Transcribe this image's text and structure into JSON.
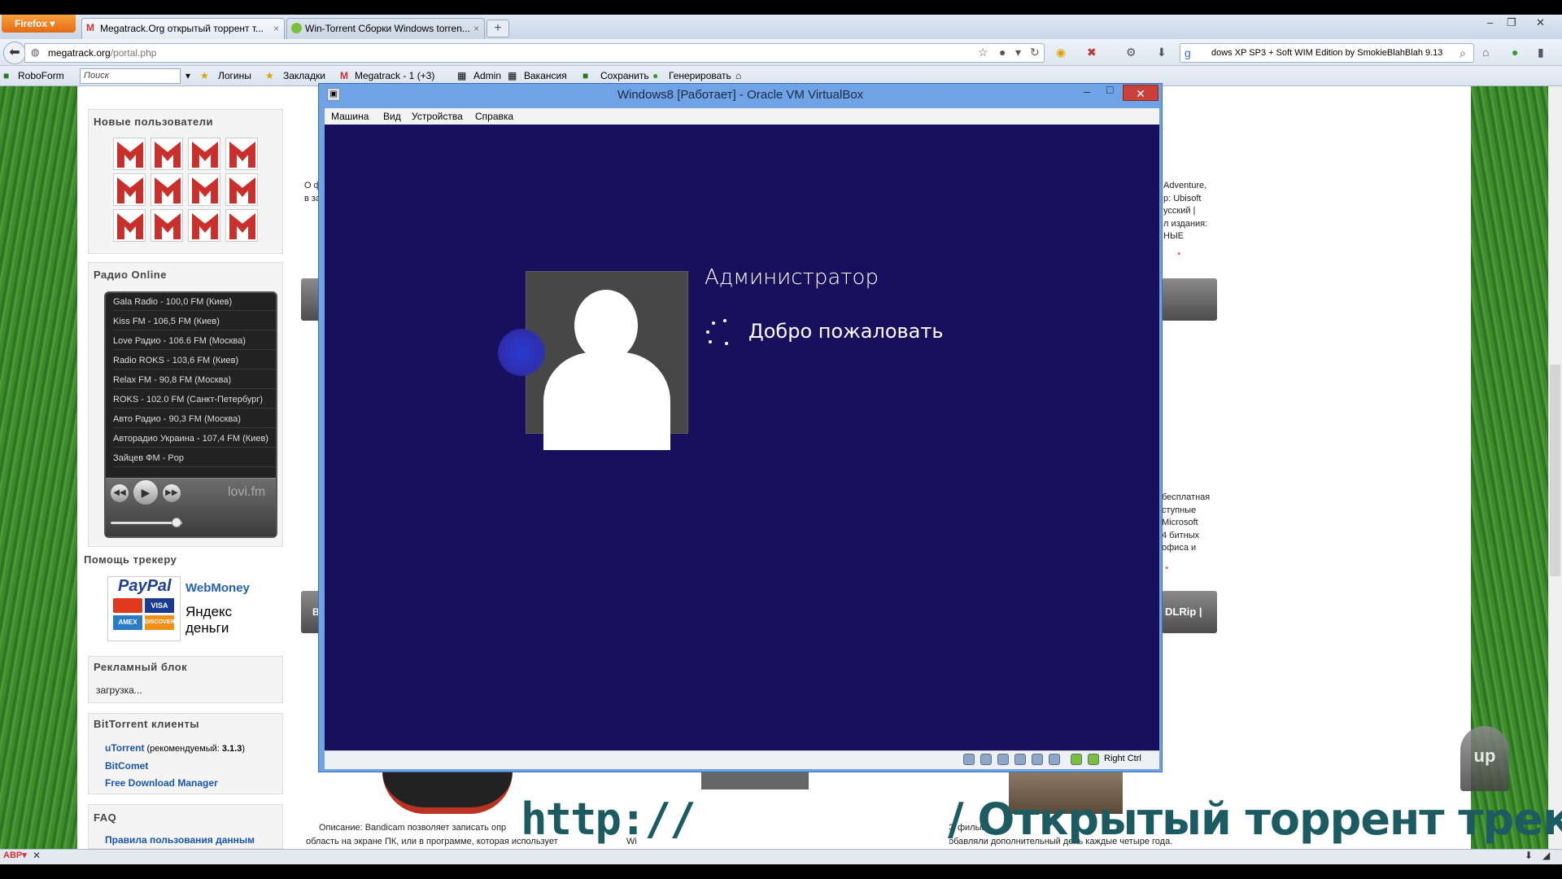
{
  "browser": {
    "app_button": "Firefox",
    "tabs": [
      {
        "label": "Megatrack.Org открытый торрент т...",
        "close": "×"
      },
      {
        "label": "Win-Torrent Сборки Windows torren...",
        "close": "×"
      }
    ],
    "new_tab": "+",
    "url_host": "megatrack.org",
    "url_path": "/portal.php",
    "search_text": "dows XP SP3 + Soft WIM Edition by SmokieBlahBlah 9.13",
    "window_controls": {
      "minimize": "–",
      "restore": "❐",
      "close": "✕"
    }
  },
  "bookmarks": {
    "roboform": "RoboForm",
    "search_placeholder": "Поиск",
    "items": [
      "Логины",
      "Закладки",
      "Megatrack - 1  (+3)",
      "Admin",
      "Вакансия",
      "Сохранить",
      "Генерировать"
    ]
  },
  "sidebar": {
    "new_users_title": "Новые пользователи",
    "radio_title": "Радио Online",
    "radio_stations": [
      "Gala Radio - 100,0 FM (Киев)",
      "Kiss FM - 106,5 FM (Киев)",
      "Love Радио - 106.6 FM (Москва)",
      "Radio ROKS - 103,6 FM (Киев)",
      "Relax FM - 90,8 FM (Москва)",
      "ROKS - 102.0 FM (Санкт-Петербург)",
      "Авто Радио - 90,3 FM (Москва)",
      "Авторадио Украина - 107,4 FM (Киев)",
      "Зайцев ФМ - Pop"
    ],
    "radio_brand": "lovi.fm",
    "radio_volume": 0.85,
    "help_title": "Помощь трекеру",
    "payment_logos": [
      "PayPal",
      "WebMoney",
      "Яндекс деньги",
      "VISA",
      "AMEX",
      "DISCOVER"
    ],
    "ads_title": "Рекламный блок",
    "ads_loading": "загрузка...",
    "bittorrent_title": "BitTorrent клиенты",
    "clients": [
      {
        "name": "uTorrent",
        "note": "(рекомендуемый:",
        "version": "3.1.3",
        "close": ")"
      },
      {
        "name": "BitComet"
      },
      {
        "name": "Free Download Manager"
      }
    ],
    "faq_title": "FAQ",
    "faq_link": "Правила пользования данным"
  },
  "page_fragments": {
    "left_text_1": "О ф",
    "left_text_2": "в за",
    "right_text": [
      "Adventure,",
      "р: Ubisoft",
      "усский |",
      "л издания:",
      "НЫЕ"
    ],
    "right_text_2": [
      "бесплатная",
      "ступные",
      "Microsoft",
      "4 битных",
      "офиса и"
    ],
    "right_button_2": "DLRip |",
    "left_button_2": "В",
    "bottom_desc": "Описание: Bandicam позволяет записать опр",
    "bottom_desc_2": "область на экране ПК, или в программе, которая использует",
    "bottom_right_1": "Э фильм",
    "bottom_right_2": "обавляли дополнительный день каждые четыре года.",
    "bottom_mid": "Wi"
  },
  "vbox": {
    "title": "Windows8 [Работает] - Oracle VM VirtualBox",
    "menu": [
      "Машина",
      "Вид",
      "Устройства",
      "Справка"
    ],
    "host_key": "Right Ctrl",
    "controls": {
      "minimize": "–",
      "maximize": "□",
      "close": "✕"
    }
  },
  "win8": {
    "username": "Администратор",
    "welcome": "Добро пожаловать"
  },
  "watermark": {
    "prefix": "http://",
    "suffix": "/ Открытый торрент трекер"
  },
  "up_button": "up",
  "colors": {
    "vm_background": "#180f5d",
    "firefox_orange": "#e46a14",
    "vbox_frame": "#6fa3e6",
    "watermark": "#1d5b63"
  }
}
